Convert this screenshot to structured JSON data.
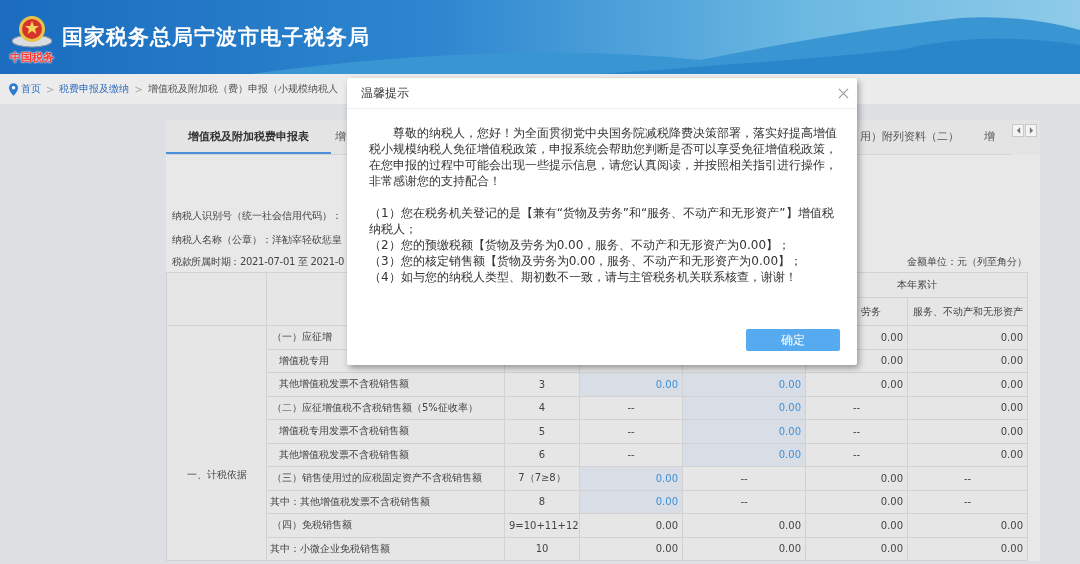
{
  "header": {
    "title": "国家税务总局宁波市电子税务局",
    "logo_caption": "中国税务"
  },
  "breadcrumb": [
    {
      "text": "首页",
      "kind": "link"
    },
    {
      "text": ">",
      "kind": "separator"
    },
    {
      "text": "税费申报及缴纳",
      "kind": "link"
    },
    {
      "text": ">",
      "kind": "separator"
    },
    {
      "text": "增值税及附加税（费）申报（小规模纳税人",
      "kind": "current"
    }
  ],
  "tabs": [
    {
      "label": "增值税及附加税费申报表",
      "selected": true
    },
    {
      "label": "增",
      "selected": false
    },
    {
      "label": "用）附列资料（二）",
      "selected": false
    },
    {
      "label": "增",
      "selected": false
    }
  ],
  "info_lines": [
    "纳税人识别号（统一社会信用代码）：",
    "纳税人名称（公章）：洋勧宰轻砍惩皇",
    "税款所属时期：2021-07-01 至 2021-0"
  ],
  "unit_note": "金额单位：元（列至角分）",
  "table": {
    "year_header": "本年累计",
    "subheaders": [
      "劳务",
      "服务、不动产和无形资产"
    ],
    "section": "一、计税依据",
    "rows": [
      {
        "item": "（一）应征增",
        "kind": "category",
        "line": null,
        "cells": [
          null,
          null,
          {
            "text": "0.00",
            "editable": false
          },
          {
            "text": "0.00",
            "editable": false
          }
        ]
      },
      {
        "item": "增值税专用",
        "kind": "detail",
        "line": null,
        "cells": [
          null,
          null,
          {
            "text": "0.00",
            "editable": false
          },
          {
            "text": "0.00",
            "editable": false
          }
        ]
      },
      {
        "item": "其他增值税发票不含税销售额",
        "kind": "detail",
        "line": "3",
        "cells": [
          {
            "text": "0.00",
            "editable": true
          },
          {
            "text": "0.00",
            "editable": true
          },
          {
            "text": "0.00",
            "editable": false
          },
          {
            "text": "0.00",
            "editable": false
          }
        ]
      },
      {
        "item": "（二）应征增值税不含税销售额（5%征收率）",
        "kind": "category",
        "line": "4",
        "cells": [
          {
            "text": "--",
            "editable": false
          },
          {
            "text": "0.00",
            "editable": true
          },
          {
            "text": "--",
            "editable": false
          },
          {
            "text": "0.00",
            "editable": false
          }
        ]
      },
      {
        "item": "增值税专用发票不含税销售额",
        "kind": "detail",
        "line": "5",
        "cells": [
          {
            "text": "--",
            "editable": false
          },
          {
            "text": "0.00",
            "editable": true
          },
          {
            "text": "--",
            "editable": false
          },
          {
            "text": "0.00",
            "editable": false
          }
        ]
      },
      {
        "item": "其他增值税发票不含税销售额",
        "kind": "detail",
        "line": "6",
        "cells": [
          {
            "text": "--",
            "editable": false
          },
          {
            "text": "0.00",
            "editable": true
          },
          {
            "text": "--",
            "editable": false
          },
          {
            "text": "0.00",
            "editable": false
          }
        ]
      },
      {
        "item": "（三）销售使用过的应税固定资产不含税销售额",
        "kind": "category",
        "line": "7（7≥8）",
        "cells": [
          {
            "text": "0.00",
            "editable": true
          },
          {
            "text": "--",
            "editable": false
          },
          {
            "text": "0.00",
            "editable": false
          },
          {
            "text": "--",
            "editable": false
          }
        ]
      },
      {
        "item": "其中：其他增值税发票不含税销售额",
        "kind": "sub",
        "line": "8",
        "cells": [
          {
            "text": "0.00",
            "editable": true
          },
          {
            "text": "--",
            "editable": false
          },
          {
            "text": "0.00",
            "editable": false
          },
          {
            "text": "--",
            "editable": false
          }
        ]
      },
      {
        "item": "（四）免税销售额",
        "kind": "category",
        "line": "9=10+11+12",
        "cells": [
          {
            "text": "0.00",
            "editable": false
          },
          {
            "text": "0.00",
            "editable": false
          },
          {
            "text": "0.00",
            "editable": false
          },
          {
            "text": "0.00",
            "editable": false
          }
        ]
      },
      {
        "item": "其中：小微企业免税销售额",
        "kind": "sub",
        "line": "10",
        "cells": [
          {
            "text": "0.00",
            "editable": false
          },
          {
            "text": "0.00",
            "editable": false
          },
          {
            "text": "0.00",
            "editable": false
          },
          {
            "text": "0.00",
            "editable": false
          }
        ]
      }
    ]
  },
  "dialog": {
    "title": "温馨提示",
    "intro": "尊敬的纳税人，您好！为全面贯彻党中央国务院减税降费决策部署，落实好提高增值税小规模纳税人免征增值税政策，申报系统会帮助您判断是否可以享受免征增值税政策，在您申报的过程中可能会出现一些提示信息，请您认真阅读，并按照相关指引进行操作，非常感谢您的支持配合！",
    "items": [
      "（1）您在税务机关登记的是【兼有“货物及劳务”和“服务、不动产和无形资产”】增值税纳税人；",
      "（2）您的预缴税额【货物及劳务为0.00，服务、不动产和无形资产为0.00】；",
      "（3）您的核定销售额【货物及劳务为0.00，服务、不动产和无形资产为0.00】；",
      "（4）如与您的纳税人类型、期初数不一致，请与主管税务机关联系核查，谢谢！"
    ],
    "confirm": "确定"
  }
}
